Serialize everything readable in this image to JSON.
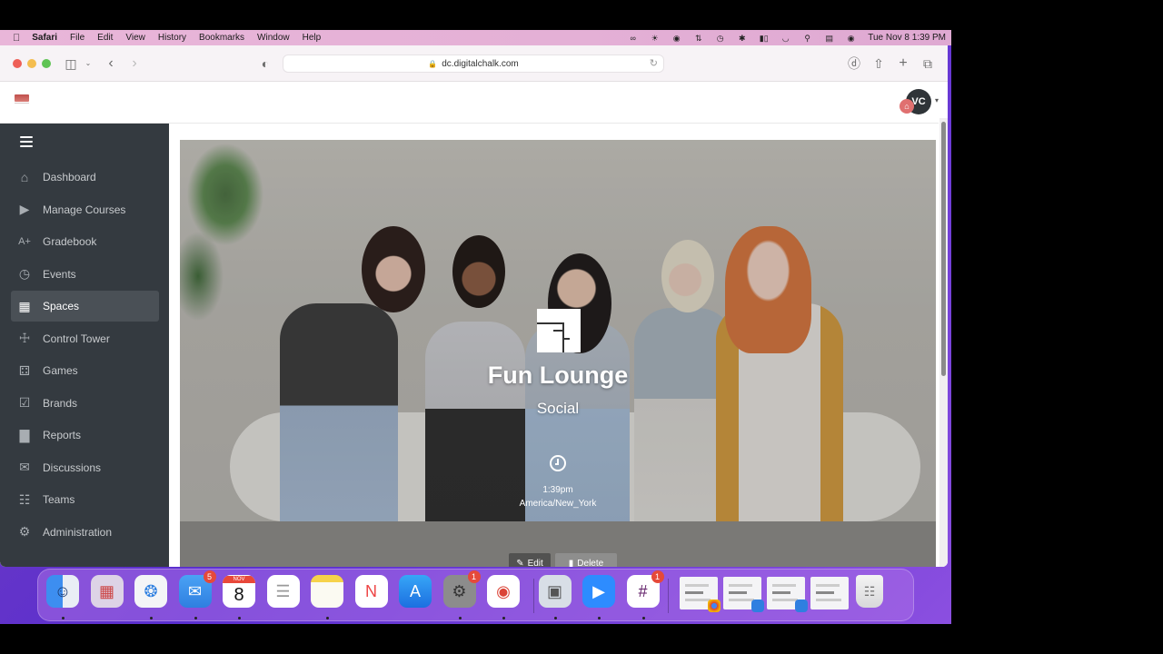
{
  "menubar": {
    "apple_icon": "apple-logo-icon",
    "app_name": "Safari",
    "menus": [
      "File",
      "Edit",
      "View",
      "History",
      "Bookmarks",
      "Window",
      "Help"
    ],
    "status_icons": [
      "creative-cloud-icon",
      "brightness-icon",
      "grammarly-icon",
      "network-icon",
      "screen-time-icon",
      "bluetooth-icon",
      "battery-icon",
      "wifi-icon",
      "spotlight-icon",
      "control-center-icon",
      "siri-icon"
    ],
    "datetime": "Tue Nov 8  1:39 PM"
  },
  "browser": {
    "url": "dc.digitalchalk.com",
    "toolbar_icons": [
      "sidebar-icon",
      "back-icon",
      "forward-icon",
      "privacy-shield-icon",
      "download-icon",
      "share-icon",
      "new-tab-icon",
      "tab-overview-icon"
    ]
  },
  "header": {
    "avatar_initials": "VC",
    "avatar_badge": "⌂"
  },
  "sidebar": {
    "items": [
      {
        "label": "Dashboard",
        "icon": "home-icon",
        "glyph": "⌂",
        "active": false
      },
      {
        "label": "Manage Courses",
        "icon": "play-square-icon",
        "glyph": "▶",
        "active": false
      },
      {
        "label": "Gradebook",
        "icon": "grade-a-plus-icon",
        "glyph": "A+",
        "active": false
      },
      {
        "label": "Events",
        "icon": "calendar-clock-icon",
        "glyph": "◷",
        "active": false
      },
      {
        "label": "Spaces",
        "icon": "spaces-icon",
        "glyph": "▦",
        "active": true
      },
      {
        "label": "Control Tower",
        "icon": "control-tower-icon",
        "glyph": "☩",
        "active": false
      },
      {
        "label": "Games",
        "icon": "dice-icon",
        "glyph": "⚃",
        "active": false
      },
      {
        "label": "Brands",
        "icon": "brand-edit-icon",
        "glyph": "☑",
        "active": false
      },
      {
        "label": "Reports",
        "icon": "bar-chart-icon",
        "glyph": "▇",
        "active": false
      },
      {
        "label": "Discussions",
        "icon": "comments-icon",
        "glyph": "✉",
        "active": false
      },
      {
        "label": "Teams",
        "icon": "org-chart-icon",
        "glyph": "☷",
        "active": false
      },
      {
        "label": "Administration",
        "icon": "gear-icon",
        "glyph": "⚙",
        "active": false
      }
    ]
  },
  "space": {
    "title": "Fun Lounge",
    "category": "Social",
    "time": "1:39pm",
    "timezone": "America/New_York",
    "edit_label": "Edit",
    "delete_label": "Delete"
  },
  "dock": {
    "apps": [
      {
        "name": "Finder",
        "icon": "finder-icon",
        "badge": null,
        "running": true
      },
      {
        "name": "Launchpad",
        "icon": "launchpad-icon",
        "badge": null,
        "running": false
      },
      {
        "name": "Safari",
        "icon": "safari-icon",
        "badge": null,
        "running": true
      },
      {
        "name": "Mail",
        "icon": "mail-icon",
        "badge": "5",
        "running": true
      },
      {
        "name": "Calendar",
        "icon": "calendar-icon",
        "badge": null,
        "running": true,
        "month": "NOV",
        "day": "8"
      },
      {
        "name": "Reminders",
        "icon": "reminders-icon",
        "badge": null,
        "running": false
      },
      {
        "name": "Notes",
        "icon": "notes-icon",
        "badge": null,
        "running": true
      },
      {
        "name": "News",
        "icon": "news-icon",
        "badge": null,
        "running": false
      },
      {
        "name": "App Store",
        "icon": "app-store-icon",
        "badge": null,
        "running": false
      },
      {
        "name": "System Preferences",
        "icon": "system-preferences-icon",
        "badge": "1",
        "running": true
      },
      {
        "name": "Chrome",
        "icon": "chrome-icon",
        "badge": null,
        "running": true
      },
      {
        "name": "Preview",
        "icon": "preview-icon",
        "badge": null,
        "running": true
      },
      {
        "name": "Zoom",
        "icon": "zoom-icon",
        "badge": null,
        "running": true
      },
      {
        "name": "Slack",
        "icon": "slack-icon",
        "badge": "1",
        "running": true
      }
    ],
    "minimized_windows": [
      "chrome-window-thumbnail",
      "mail-window-thumbnail",
      "mail-window-thumbnail",
      "document-window-thumbnail"
    ],
    "trash": "trash-icon"
  }
}
